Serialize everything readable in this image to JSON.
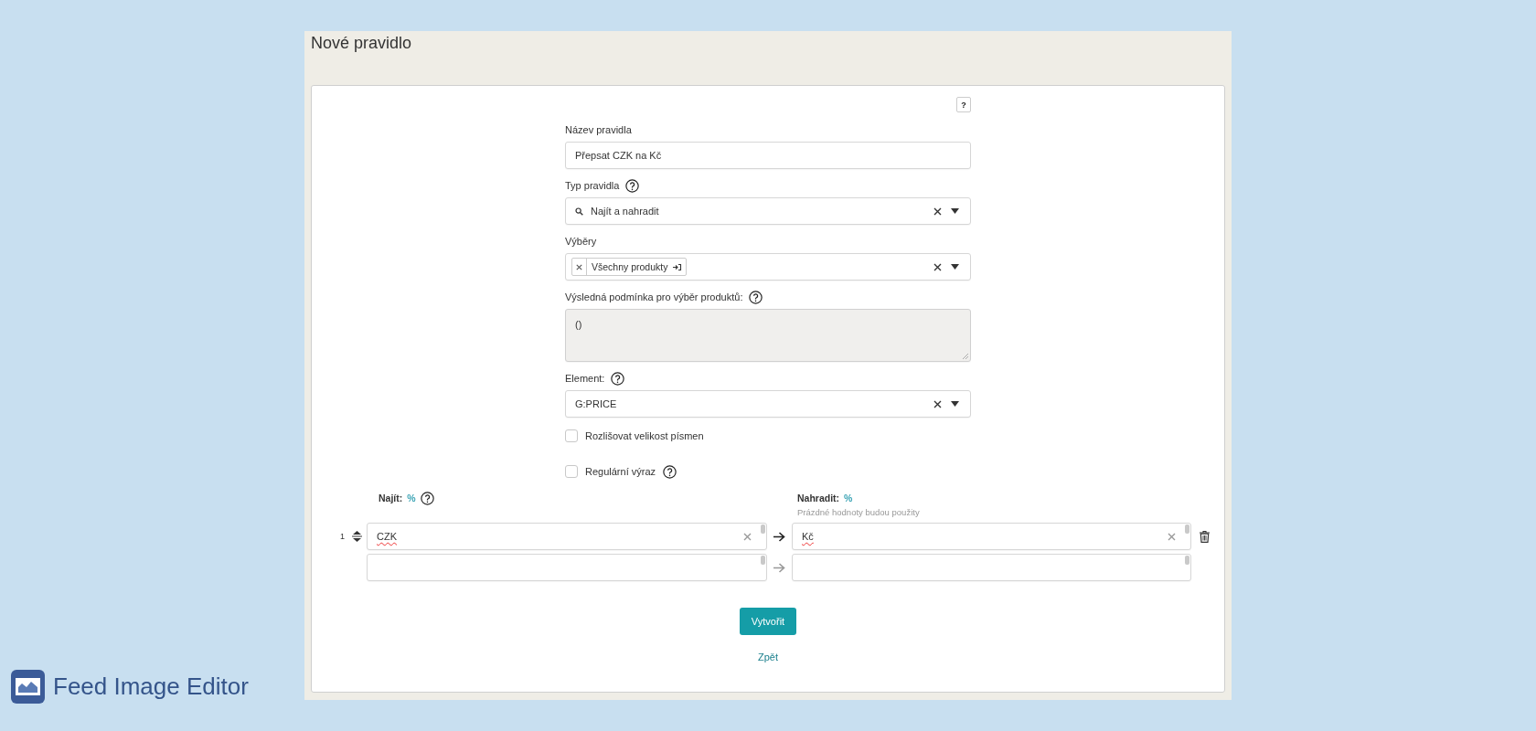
{
  "page_title": "Nové pravidlo",
  "help_button": "?",
  "fields": [
    {
      "kind": "text",
      "label": "Název pravidla",
      "help": false,
      "value": "Přepsat CZK na Kč"
    },
    {
      "kind": "search-select",
      "label": "Typ pravidla",
      "help": true,
      "value": "Najít a nahradit"
    },
    {
      "kind": "tags",
      "label": "Výběry",
      "help": false,
      "tags": [
        "Všechny produkty"
      ]
    },
    {
      "kind": "textarea",
      "label": "Výsledná podmínka pro výběr produktů:",
      "help": true,
      "value": "()",
      "disabled": true
    },
    {
      "kind": "select",
      "label": "Element:",
      "help": true,
      "value": "G:PRICE"
    }
  ],
  "checkboxes": [
    {
      "label": "Rozlišovat velikost písmen",
      "checked": false,
      "help": false
    },
    {
      "label": "Regulární výraz",
      "checked": false,
      "help": true
    }
  ],
  "find_header": {
    "label": "Najít:",
    "token": "%",
    "help": true
  },
  "replace_header": {
    "label": "Nahradit:",
    "token": "%",
    "hint": "Prázdné hodnoty budou použity"
  },
  "pairs": [
    {
      "number": "1",
      "find": "CZK",
      "replace": "Kč",
      "active": true
    },
    {
      "active": false
    }
  ],
  "submit_button": "Vytvořit",
  "back_link": "Zpět",
  "brand": "Feed Image Editor"
}
